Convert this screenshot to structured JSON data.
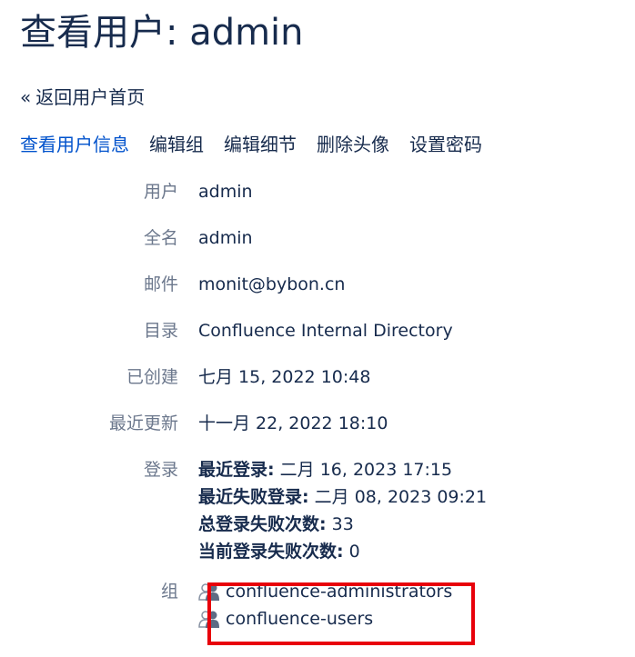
{
  "page_title": "查看用户: admin",
  "back_link": {
    "arrow": "«",
    "label": "返回用户首页"
  },
  "tabs": [
    {
      "label": "查看用户信息",
      "active": true
    },
    {
      "label": "编辑组",
      "active": false
    },
    {
      "label": "编辑细节",
      "active": false
    },
    {
      "label": "删除头像",
      "active": false
    },
    {
      "label": "设置密码",
      "active": false
    }
  ],
  "details": {
    "username": {
      "label": "用户",
      "value": "admin"
    },
    "fullname": {
      "label": "全名",
      "value": "admin"
    },
    "email": {
      "label": "邮件",
      "value": "monit@bybon.cn"
    },
    "directory": {
      "label": "目录",
      "value": "Confluence Internal Directory"
    },
    "created": {
      "label": "已创建",
      "value": "七月 15, 2022 10:48"
    },
    "updated": {
      "label": "最近更新",
      "value": "十一月 22, 2022 18:10"
    },
    "login": {
      "label": "登录",
      "last_login_label": "最近登录:",
      "last_login_value": " 二月 16, 2023 17:15",
      "last_failed_label": "最近失败登录:",
      "last_failed_value": " 二月 08, 2023 09:21",
      "total_failed_label": "总登录失败次数:",
      "total_failed_value": " 33",
      "current_failed_label": "当前登录失败次数:",
      "current_failed_value": " 0"
    },
    "groups": {
      "label": "组",
      "items": [
        {
          "name": "confluence-administrators",
          "icon": "group-icon"
        },
        {
          "name": "confluence-users",
          "icon": "group-icon"
        }
      ]
    }
  },
  "colors": {
    "text": "#172b4d",
    "label": "#6b778c",
    "active_tab": "#0052cc",
    "highlight_border": "#e8000b"
  }
}
